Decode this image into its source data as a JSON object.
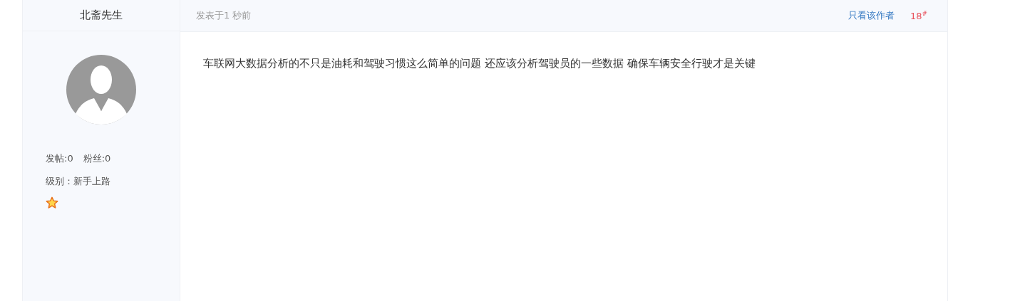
{
  "author": {
    "name": "北斋先生",
    "stats": [
      {
        "label": "发帖:0"
      },
      {
        "label": "粉丝:0"
      }
    ],
    "level": "级别：新手上路",
    "rank_badges": [
      {
        "kind": "star"
      }
    ]
  },
  "post": {
    "posted": "发表于1 秒前",
    "only_author_link": "只看该作者",
    "floor": "18$^{#}$",
    "content": "车联网大数据分析的不只是油耗和驾驶习惯这么简单的问题 还应该分析驾驶员的一些数据 确保车辆安全行驶才是关键"
  }
}
